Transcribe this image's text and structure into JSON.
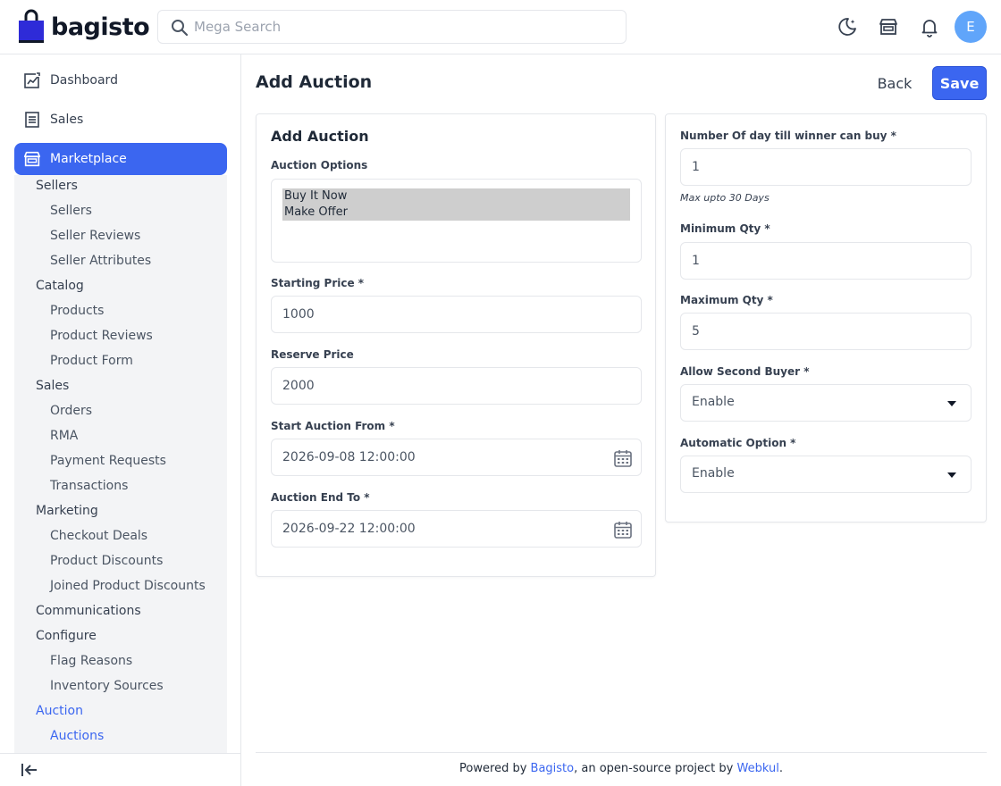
{
  "brand": {
    "name": "bagisto"
  },
  "search": {
    "placeholder": "Mega Search"
  },
  "header": {
    "avatar_initial": "E"
  },
  "sidebar": {
    "top_items": [
      {
        "label": "Dashboard"
      },
      {
        "label": "Sales"
      },
      {
        "label": "Marketplace"
      }
    ],
    "marketplace_children": [
      {
        "label": "Sellers",
        "level": 1
      },
      {
        "label": "Sellers",
        "level": 2
      },
      {
        "label": "Seller Reviews",
        "level": 2
      },
      {
        "label": "Seller Attributes",
        "level": 2
      },
      {
        "label": "Catalog",
        "level": 1
      },
      {
        "label": "Products",
        "level": 2
      },
      {
        "label": "Product Reviews",
        "level": 2
      },
      {
        "label": "Product Form",
        "level": 2
      },
      {
        "label": "Sales",
        "level": 1
      },
      {
        "label": "Orders",
        "level": 2
      },
      {
        "label": "RMA",
        "level": 2
      },
      {
        "label": "Payment Requests",
        "level": 2
      },
      {
        "label": "Transactions",
        "level": 2
      },
      {
        "label": "Marketing",
        "level": 1
      },
      {
        "label": "Checkout Deals",
        "level": 2
      },
      {
        "label": "Product Discounts",
        "level": 2
      },
      {
        "label": "Joined Product Discounts",
        "level": 2
      },
      {
        "label": "Communications",
        "level": 1
      },
      {
        "label": "Configure",
        "level": 1
      },
      {
        "label": "Flag Reasons",
        "level": 2
      },
      {
        "label": "Inventory Sources",
        "level": 2
      },
      {
        "label": "Auction",
        "level": 1
      },
      {
        "label": "Auctions",
        "level": 2
      }
    ]
  },
  "page": {
    "title": "Add Auction",
    "back_label": "Back",
    "save_label": "Save"
  },
  "left_card": {
    "title": "Add Auction",
    "auction_options_label": "Auction Options",
    "auction_options": [
      "Buy It Now",
      "Make Offer"
    ],
    "starting_price_label": "Starting Price *",
    "starting_price_value": "1000",
    "reserve_price_label": "Reserve Price",
    "reserve_price_value": "2000",
    "start_from_label": "Start Auction From *",
    "start_from_value": "2026-09-08 12:00:00",
    "end_to_label": "Auction End To *",
    "end_to_value": "2026-09-22 12:00:00"
  },
  "right_card": {
    "days_label": "Number Of day till winner can buy *",
    "days_value": "1",
    "days_hint": "Max upto 30 Days",
    "min_qty_label": "Minimum Qty *",
    "min_qty_value": "1",
    "max_qty_label": "Maximum Qty *",
    "max_qty_value": "5",
    "second_buyer_label": "Allow Second Buyer *",
    "second_buyer_value": "Enable",
    "automatic_label": "Automatic Option *",
    "automatic_value": "Enable"
  },
  "footer": {
    "prefix": "Powered by ",
    "link1": "Bagisto",
    "middle": ", an open-source project by ",
    "link2": "Webkul",
    "suffix": "."
  },
  "colors": {
    "accent": "#3b66f0",
    "avatar": "#60a5fa",
    "logo_bag": "#4f46e5"
  }
}
